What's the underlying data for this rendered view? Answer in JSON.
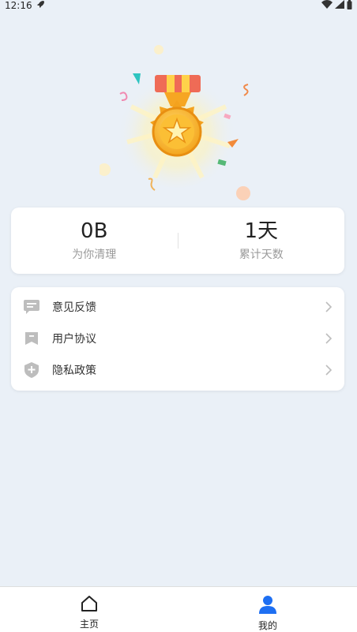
{
  "status_bar": {
    "time": "12:16",
    "icons": [
      "rocket-icon",
      "wifi-icon",
      "signal-icon",
      "battery-icon"
    ]
  },
  "hero": {
    "image": "medal-illustration"
  },
  "stats": [
    {
      "value": "0B",
      "label": "为你清理"
    },
    {
      "value": "1天",
      "label": "累计天数"
    }
  ],
  "menu": [
    {
      "icon": "message-icon",
      "label": "意见反馈"
    },
    {
      "icon": "bookmark-icon",
      "label": "用户协议"
    },
    {
      "icon": "shield-icon",
      "label": "隐私政策"
    }
  ],
  "bottom_nav": [
    {
      "icon": "home-icon",
      "label": "主页",
      "active": false
    },
    {
      "icon": "person-icon",
      "label": "我的",
      "active": true
    }
  ],
  "colors": {
    "background": "#eaf0f7",
    "accent": "#1e6ff2",
    "card": "#ffffff",
    "muted_text": "#9a9a9a",
    "icon_gray": "#bdbdbd"
  }
}
